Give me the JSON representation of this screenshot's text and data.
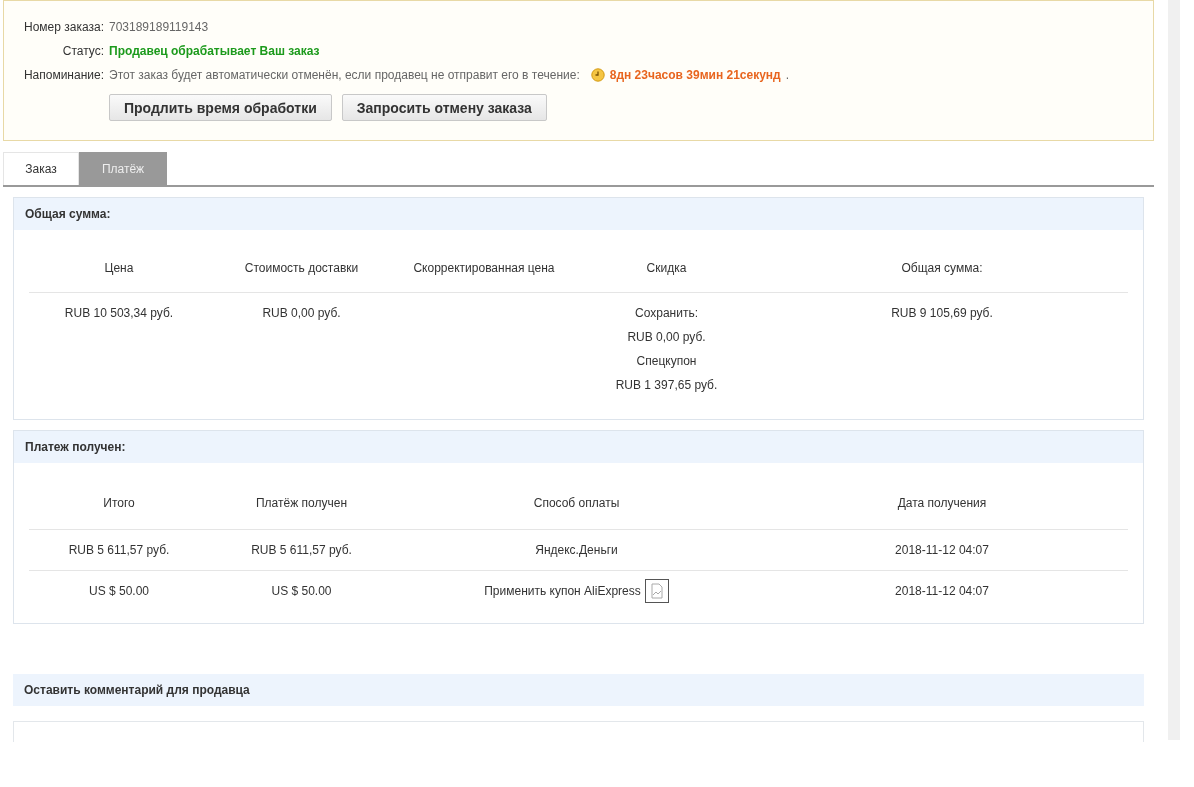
{
  "order": {
    "number_label": "Номер заказа:",
    "number": "703189189119143",
    "status_label": "Статус:",
    "status": "Продавец обрабатывает Ваш заказ",
    "reminder_label": "Напоминание:",
    "reminder": "Этот заказ будет автоматически отменён, если продавец не отправит его в течение:",
    "countdown": "8дн 23часов 39мин 21секунд",
    "countdown_end": ".",
    "buttons": [
      "Продлить время обработки",
      "Запросить отмену заказа"
    ]
  },
  "tabs": [
    {
      "label": "Заказ",
      "selected": false
    },
    {
      "label": "Платёж",
      "selected": true
    }
  ],
  "summary": {
    "title": "Общая сумма:",
    "columns": [
      "Цена",
      "Стоимость доставки",
      "Скорректированная цена",
      "Скидка",
      "Общая сумма:"
    ],
    "rows": [
      [
        [
          "RUB 10 503,34 руб."
        ],
        [
          "RUB 0,00 руб."
        ],
        [],
        [
          "Сохранить:",
          "RUB 0,00 руб.",
          "Спецкупон",
          "RUB 1 397,65 руб."
        ],
        [
          "RUB 9 105,69 руб."
        ]
      ]
    ]
  },
  "payment": {
    "title": "Платеж получен:",
    "columns": [
      "Итого",
      "Платёж получен",
      "Способ оплаты",
      "Дата получения"
    ],
    "rows": [
      {
        "total": "RUB 5 611,57 руб.",
        "received": "RUB 5 611,57 руб.",
        "method": "Яндекс.Деньги",
        "method_image": false,
        "date": "2018-11-12 04:07"
      },
      {
        "total": "US $ 50.00",
        "received": "US $ 50.00",
        "method": "Применить купон AliExpress",
        "method_image": true,
        "date": "2018-11-12 04:07"
      }
    ]
  },
  "comment": {
    "title": "Оставить комментарий для продавца"
  }
}
